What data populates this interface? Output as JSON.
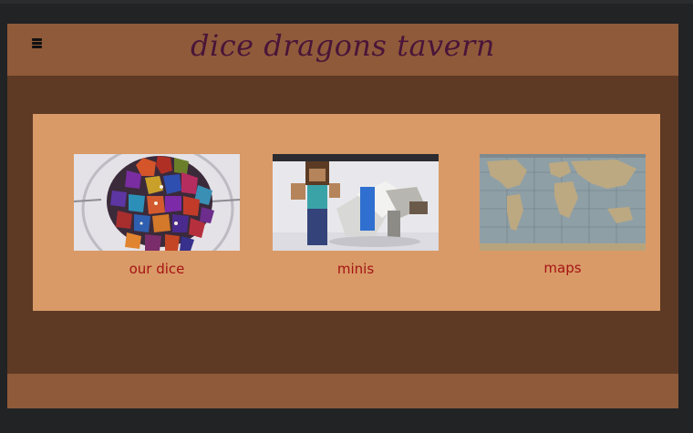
{
  "site": {
    "title": "dice dragons tavern"
  },
  "gallery": {
    "items": [
      {
        "caption": "our dice",
        "image": "dice-photo"
      },
      {
        "caption": "minis",
        "image": "minis-photo"
      },
      {
        "caption": "maps",
        "image": "world-map-photo"
      }
    ]
  },
  "colors": {
    "page_background": "#5e3a24",
    "header_footer": "#8f5a3a",
    "gallery_panel": "#d99a67",
    "title_text": "#4a1538",
    "caption_text": "#a51313"
  },
  "icons": {
    "menu": "hamburger-menu-icon"
  }
}
